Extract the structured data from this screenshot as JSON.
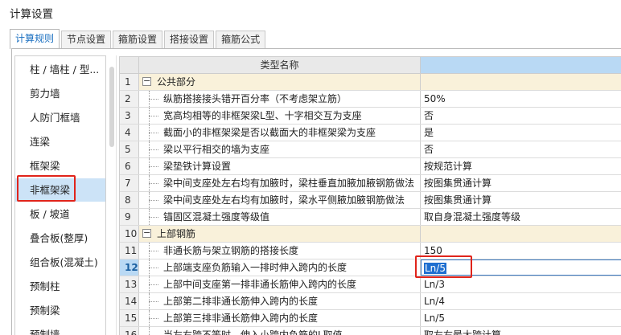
{
  "window": {
    "title": "计算设置"
  },
  "tabs": [
    {
      "label": "计算规则",
      "active": true
    },
    {
      "label": "节点设置",
      "active": false
    },
    {
      "label": "箍筋设置",
      "active": false
    },
    {
      "label": "搭接设置",
      "active": false
    },
    {
      "label": "箍筋公式",
      "active": false
    }
  ],
  "sidebar": {
    "items": [
      {
        "label": "柱 / 墙柱 / 型..."
      },
      {
        "label": "剪力墙"
      },
      {
        "label": "人防门框墙"
      },
      {
        "label": "连梁"
      },
      {
        "label": "框架梁"
      },
      {
        "label": "非框架梁",
        "selected": true
      },
      {
        "label": "板 / 坡道"
      },
      {
        "label": "叠合板(整厚)"
      },
      {
        "label": "组合板(混凝土)"
      },
      {
        "label": "预制柱"
      },
      {
        "label": "预制梁"
      },
      {
        "label": "预制墙"
      }
    ]
  },
  "grid": {
    "header": {
      "name": "类型名称",
      "value": ""
    },
    "rows": [
      {
        "no": "1",
        "name": "公共部分",
        "value": "",
        "group": true
      },
      {
        "no": "2",
        "name": "纵筋搭接接头错开百分率（不考虑架立筋）",
        "value": "50%"
      },
      {
        "no": "3",
        "name": "宽高均相等的非框架梁L型、十字相交互为支座",
        "value": "否"
      },
      {
        "no": "4",
        "name": "截面小的非框架梁是否以截面大的非框架梁为支座",
        "value": "是"
      },
      {
        "no": "5",
        "name": "梁以平行相交的墙为支座",
        "value": "否"
      },
      {
        "no": "6",
        "name": "梁垫铁计算设置",
        "value": "按规范计算"
      },
      {
        "no": "7",
        "name": "梁中间支座处左右均有加腋时，梁柱垂直加腋加腋钢筋做法",
        "value": "按图集贯通计算"
      },
      {
        "no": "8",
        "name": "梁中间支座处左右均有加腋时，梁水平侧腋加腋钢筋做法",
        "value": "按图集贯通计算"
      },
      {
        "no": "9",
        "name": "锚固区混凝土强度等级值",
        "value": "取自身混凝土强度等级"
      },
      {
        "no": "10",
        "name": "上部钢筋",
        "value": "",
        "group": true
      },
      {
        "no": "11",
        "name": "非通长筋与架立钢筋的搭接长度",
        "value": "150"
      },
      {
        "no": "12",
        "name": "上部端支座负筋输入一排时伸入跨内的长度",
        "value": "Ln/5",
        "editing": true
      },
      {
        "no": "13",
        "name": "上部中间支座第一排非通长筋伸入跨内的长度",
        "value": "Ln/3"
      },
      {
        "no": "14",
        "name": "上部第二排非通长筋伸入跨内的长度",
        "value": "Ln/4"
      },
      {
        "no": "15",
        "name": "上部第三排非通长筋伸入跨内的长度",
        "value": "Ln/5"
      },
      {
        "no": "16",
        "name": "当左右跨不等时，伸入小跨内负筋的L取值",
        "value": "取左右最大跨计算"
      }
    ]
  },
  "colors": {
    "selection": "#cce3f7",
    "group_row": "#f9f1da",
    "highlight_box": "#e0241b",
    "active_tab_text": "#1a6fc0"
  }
}
